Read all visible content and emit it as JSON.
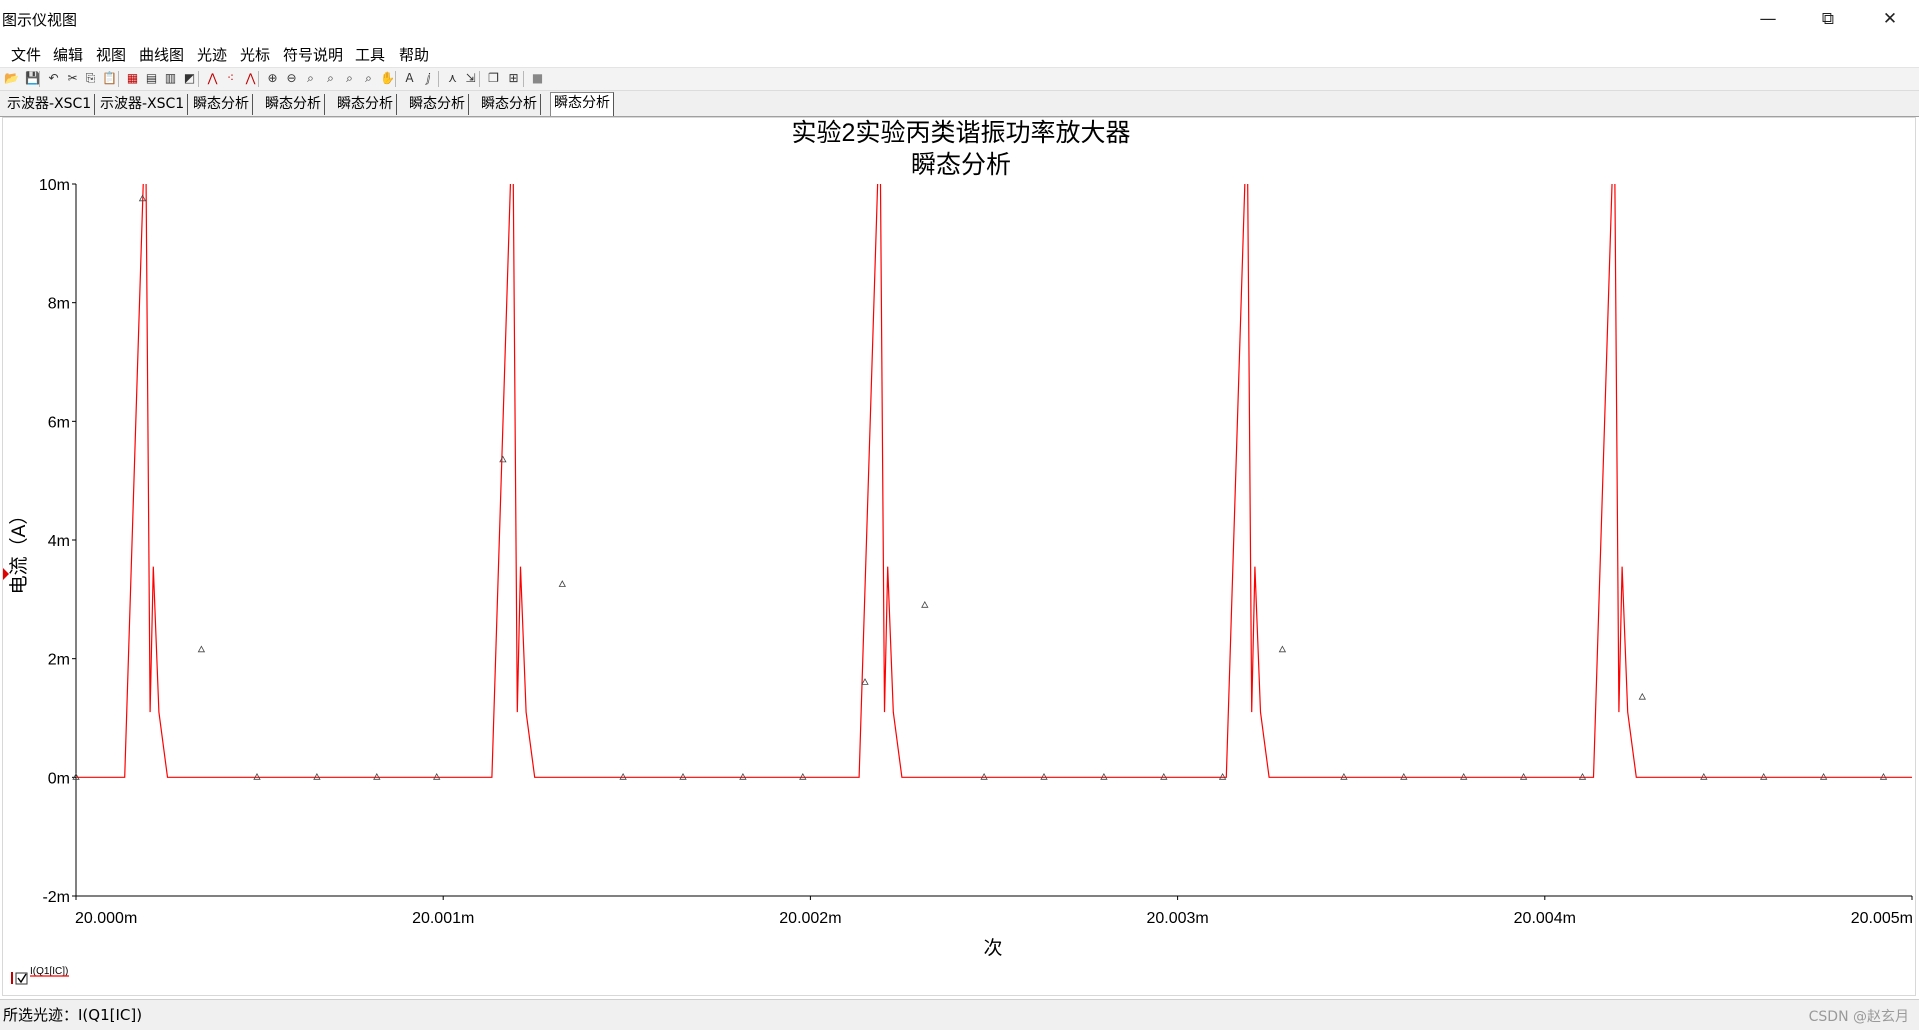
{
  "window": {
    "title": "图示仪视图",
    "minimize": "—",
    "restore": "⧉",
    "close": "✕"
  },
  "menu": [
    "文件",
    "编辑",
    "视图",
    "曲线图",
    "光迹",
    "光标",
    "符号说明",
    "工具",
    "帮助"
  ],
  "toolbar_icons": [
    {
      "name": "open-icon",
      "glyph": "📂"
    },
    {
      "name": "save-icon",
      "glyph": "💾"
    },
    {
      "name": "undo-icon",
      "glyph": "↶"
    },
    {
      "name": "cut-icon",
      "glyph": "✂"
    },
    {
      "name": "copy-icon",
      "glyph": "⎘"
    },
    {
      "name": "paste-icon",
      "glyph": "📋"
    },
    {
      "name": "grid-icon",
      "glyph": "▦"
    },
    {
      "name": "legend-icon",
      "glyph": "▤"
    },
    {
      "name": "graph-properties-icon",
      "glyph": "▥"
    },
    {
      "name": "reverse-colors-icon",
      "glyph": "◩"
    },
    {
      "name": "show-cursors-icon",
      "glyph": "⋀"
    },
    {
      "name": "data-markers-icon",
      "glyph": "⁖"
    },
    {
      "name": "cursor-marks-icon",
      "glyph": "⋀"
    },
    {
      "name": "zoom-in-icon",
      "glyph": "⊕"
    },
    {
      "name": "zoom-out-icon",
      "glyph": "⊖"
    },
    {
      "name": "zoom-area-icon",
      "glyph": "⌕"
    },
    {
      "name": "zoom-x-icon",
      "glyph": "⌕"
    },
    {
      "name": "zoom-y-icon",
      "glyph": "⌕"
    },
    {
      "name": "zoom-full-icon",
      "glyph": "⌕"
    },
    {
      "name": "pan-hand-icon",
      "glyph": "✋"
    },
    {
      "name": "text-annotation-icon",
      "glyph": "A"
    },
    {
      "name": "label-icon",
      "glyph": "ⅉ"
    },
    {
      "name": "add-trace-icon",
      "glyph": "⋏"
    },
    {
      "name": "export-icon",
      "glyph": "⇲"
    },
    {
      "name": "overlay-icon",
      "glyph": "❐"
    },
    {
      "name": "export-excel-icon",
      "glyph": "⊞"
    },
    {
      "name": "stop-icon",
      "glyph": "■"
    }
  ],
  "tabs": [
    "示波器-XSC1",
    "示波器-XSC1",
    "瞬态分析",
    "瞬态分析",
    "瞬态分析",
    "瞬态分析",
    "瞬态分析",
    "瞬态分析"
  ],
  "active_tab": 7,
  "chart_data": {
    "type": "line",
    "title": "实验2实验丙类谐振功率放大器",
    "subtitle": "瞬态分析",
    "xlabel": "次",
    "ylabel": "电流（A）",
    "x_unit": "s",
    "y_unit": "A",
    "xlim": [
      0.02,
      0.020005
    ],
    "ylim": [
      -0.002,
      0.01
    ],
    "xticks": [
      0.02,
      0.020001,
      0.020002,
      0.020003,
      0.020004,
      0.020005
    ],
    "xtick_labels": [
      "20.000m",
      "20.001m",
      "20.002m",
      "20.003m",
      "20.004m",
      "20.005m"
    ],
    "yticks": [
      -0.002,
      0,
      0.002,
      0.004,
      0.006,
      0.008,
      0.01
    ],
    "ytick_labels": [
      "-2m",
      "0m",
      "2m",
      "4m",
      "6m",
      "8m",
      "10m"
    ],
    "grid": false,
    "legend": "bottom-left",
    "series": [
      {
        "name": "I(Q1[IC])",
        "color": "#ff0000",
        "x": [
          0.02,
          0.0200001327,
          0.020000184,
          0.0200001906,
          0.0200002019,
          0.0200002106,
          0.0200002258,
          0.0200002491,
          0.0200011327,
          0.020001184,
          0.0200011906,
          0.0200012019,
          0.0200012106,
          0.0200012258,
          0.0200012491,
          0.0200021327,
          0.020002184,
          0.0200021906,
          0.0200022019,
          0.0200022106,
          0.0200022258,
          0.0200022491,
          0.0200031327,
          0.020003184,
          0.0200031906,
          0.0200032019,
          0.0200032106,
          0.0200032258,
          0.0200032491,
          0.0200041327,
          0.020004184,
          0.0200041906,
          0.0200042019,
          0.0200042106,
          0.0200042258,
          0.0200042491,
          0.020005
        ],
        "y": [
          0,
          0,
          0.0102,
          0.0102,
          0.0011,
          0.00355,
          0.0011,
          0,
          0,
          0.0102,
          0.0102,
          0.0011,
          0.00355,
          0.0011,
          0,
          0,
          0.0102,
          0.0102,
          0.0011,
          0.00355,
          0.0011,
          0,
          0,
          0.0102,
          0.0102,
          0.0011,
          0.00355,
          0.0011,
          0,
          0,
          0.0102,
          0.0102,
          0.0011,
          0.00355,
          0.0011,
          0,
          0
        ],
        "markers": [
          [
            0.02,
            0
          ],
          [
            0.0200001811,
            0.00975
          ],
          [
            0.0200003416,
            0.00215
          ],
          [
            0.020000493,
            0
          ],
          [
            0.0200006561,
            0
          ],
          [
            0.0200008192,
            0
          ],
          [
            0.0200009823,
            0
          ],
          [
            0.0200011627,
            0.00535
          ],
          [
            0.0200013244,
            0.00325
          ],
          [
            0.02000149,
            0
          ],
          [
            0.0200016531,
            0
          ],
          [
            0.0200018162,
            0
          ],
          [
            0.0200019793,
            0
          ],
          [
            0.0200021486,
            0.0016
          ],
          [
            0.0200023115,
            0.0029
          ],
          [
            0.020002473,
            0
          ],
          [
            0.0200026361,
            0
          ],
          [
            0.0200027992,
            0
          ],
          [
            0.0200029623,
            0
          ],
          [
            0.0200031226,
            0
          ],
          [
            0.0200032855,
            0.00215
          ],
          [
            0.020003453,
            0
          ],
          [
            0.0200036161,
            0
          ],
          [
            0.0200037792,
            0
          ],
          [
            0.0200039423,
            0
          ],
          [
            0.0200041026,
            0
          ],
          [
            0.0200042655,
            0.00135
          ],
          [
            0.020004433,
            0
          ],
          [
            0.0200045961,
            0
          ],
          [
            0.0200047592,
            0
          ],
          [
            0.0200049223,
            0
          ]
        ]
      }
    ]
  },
  "legend": {
    "label": "I(Q1[IC])",
    "checked": "☑"
  },
  "status": {
    "label": "所选光迹：I(Q1[IC])",
    "watermark": "CSDN @赵玄月"
  }
}
